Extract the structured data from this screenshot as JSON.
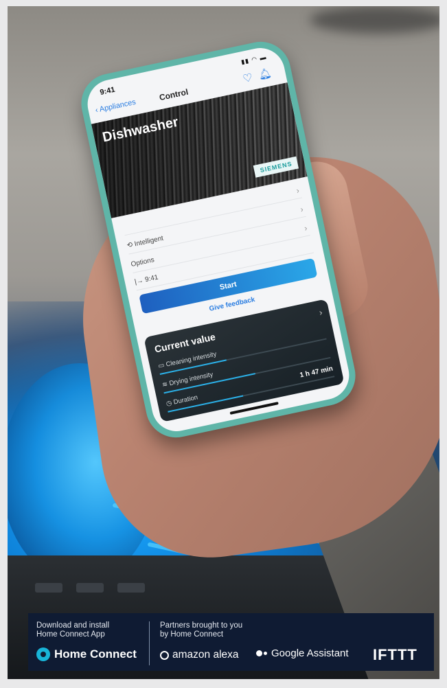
{
  "phone": {
    "status_time": "9:41",
    "back_label": "Appliances",
    "nav_title": "Control",
    "hero_title": "Dishwasher",
    "brand_badge": "SIEMENS",
    "rows": [
      {
        "label": ""
      },
      {
        "label": "Intelligent"
      },
      {
        "label": "Options"
      },
      {
        "label": "9:41"
      }
    ],
    "start_label": "Start",
    "feedback_label": "Give feedback",
    "card": {
      "title": "Current value",
      "metrics": [
        {
          "label": "Cleaning intensity",
          "value": ""
        },
        {
          "label": "Drying intensity",
          "value": ""
        },
        {
          "label": "Duration",
          "value": "1 h 47 min"
        }
      ]
    }
  },
  "banner": {
    "left_text_line1": "Download and install",
    "left_text_line2": "Home Connect App",
    "home_connect": "Home Connect",
    "mid_text_line1": "Partners brought to you",
    "mid_text_line2": "by Home Connect",
    "alexa": "amazon alexa",
    "google_assistant": "Google Assistant",
    "ifttt": "IFTTT"
  }
}
